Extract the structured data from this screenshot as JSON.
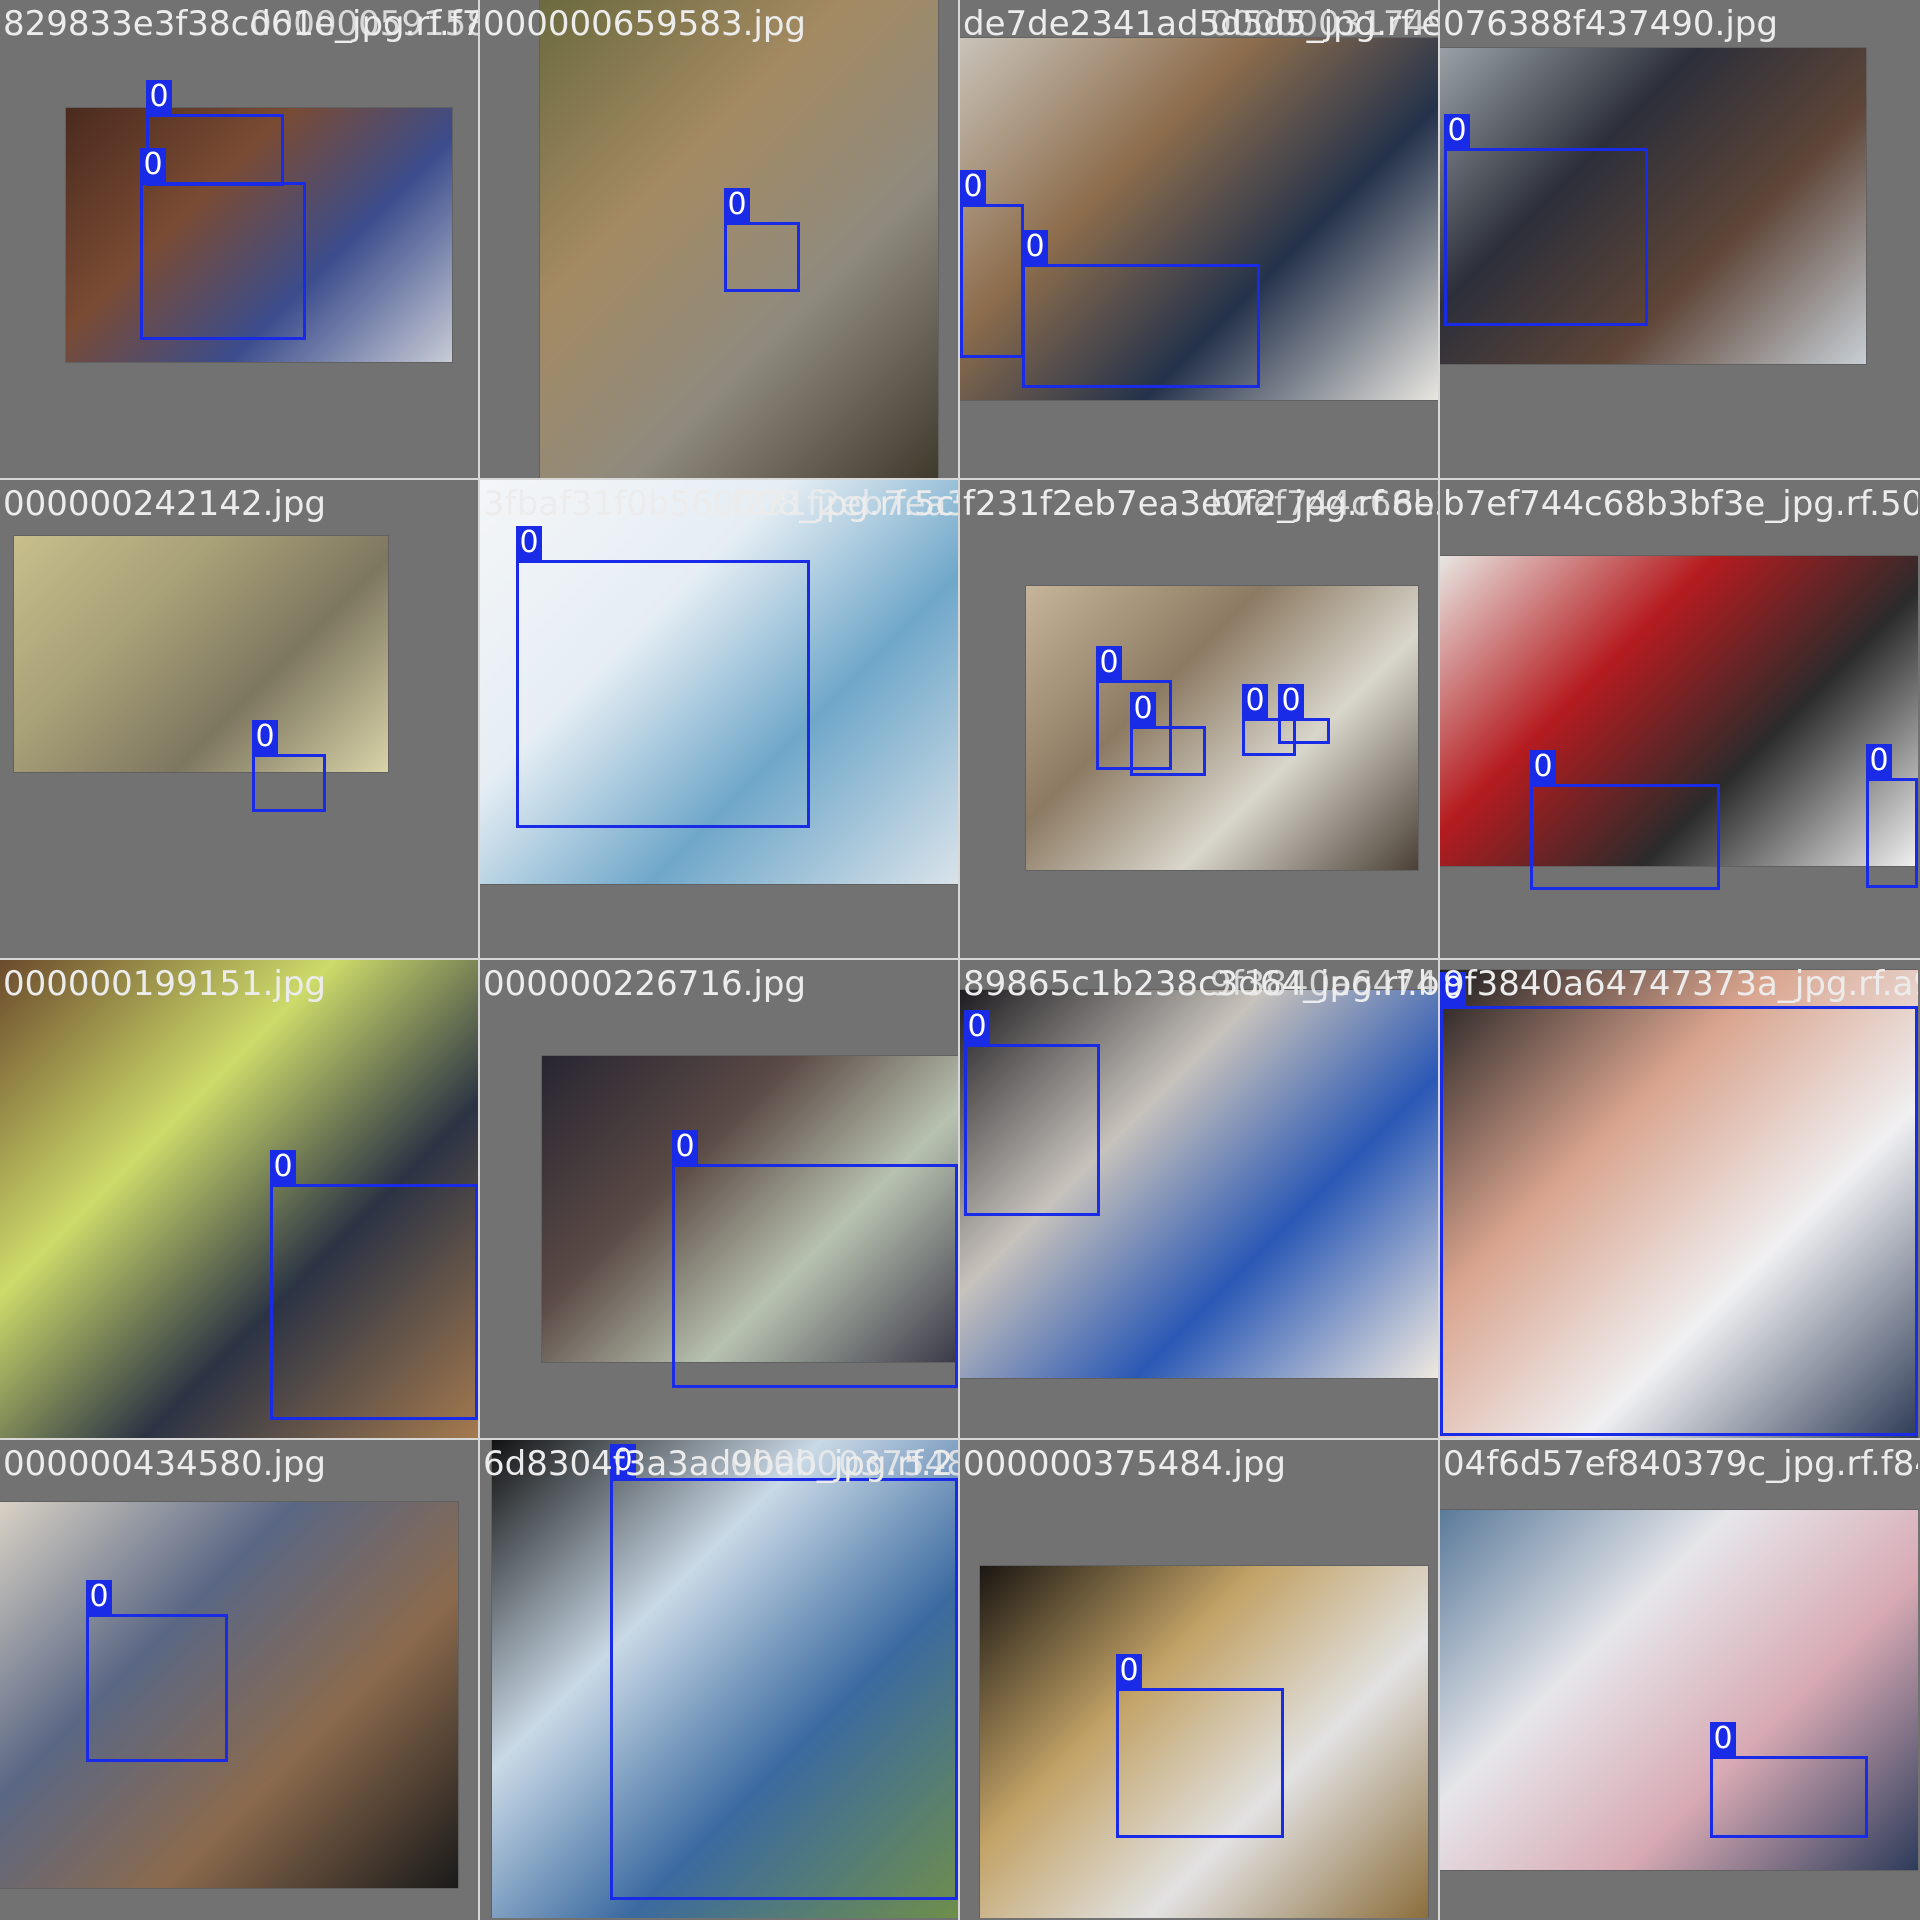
{
  "grid": {
    "tiles": [
      {
        "filename": "829833e3f38cd61e_jpg.rf.f7",
        "overlay": "000000591583.jpg",
        "colors": [
          "#4a2a1e",
          "#7a4b33",
          "#3b4c8c",
          "#c8ccd6"
        ],
        "boxes": [
          {
            "label": "0"
          },
          {
            "label": "0"
          }
        ]
      },
      {
        "filename": "000000659583.jpg",
        "overlay": "",
        "colors": [
          "#6b6a3e",
          "#a48a62",
          "#8f8a7e",
          "#3f3a2c"
        ],
        "boxes": [
          {
            "label": "0"
          }
        ]
      },
      {
        "filename": "de7de2341ad5d5d5_jpg.rf.e",
        "overlay": "000000317490.jpg",
        "colors": [
          "#c9c3b9",
          "#8d6d4c",
          "#24324b",
          "#e8e6e0"
        ],
        "boxes": [
          {
            "label": "0"
          },
          {
            "label": "0"
          }
        ]
      },
      {
        "filename": "076388f437490.jpg",
        "overlay": "",
        "colors": [
          "#9aa1a6",
          "#2c2f3a",
          "#5e4537",
          "#c7cfd6"
        ],
        "boxes": [
          {
            "label": "0"
          }
        ]
      },
      {
        "filename": "000000242142.jpg",
        "overlay": "",
        "colors": [
          "#c8bf8c",
          "#a79f76",
          "#7e7760",
          "#d8d3a8"
        ],
        "boxes": [
          {
            "label": "0"
          }
        ]
      },
      {
        "filename": "3fbaf31f0b560008_jpg.rf.5c9",
        "overlay": "f231f2eb7ea3e0f2_jpg.rf.6e5",
        "colors": [
          "#f4f6f8",
          "#e6eef4",
          "#6fa7c9",
          "#d9e3ea"
        ],
        "boxes": [
          {
            "label": "0"
          }
        ]
      },
      {
        "filename": "f231f2eb7ea3e0f2_jpg.rf.6e5",
        "overlay": "b7ef744c68b3bf3e_jpg.rf.50",
        "colors": [
          "#c6b59a",
          "#8c7a62",
          "#d9d6cc",
          "#4b4036"
        ],
        "boxes": [
          {
            "label": "0"
          },
          {
            "label": "0"
          },
          {
            "label": "0"
          },
          {
            "label": "0"
          }
        ]
      },
      {
        "filename": "b7ef744c68b3bf3e_jpg.rf.50",
        "overlay": "",
        "colors": [
          "#e8e6e2",
          "#b51b1f",
          "#2b2b2b",
          "#f2f2f2"
        ],
        "boxes": [
          {
            "label": "0"
          },
          {
            "label": "0"
          }
        ]
      },
      {
        "filename": "000000199151.jpg",
        "overlay": "",
        "colors": [
          "#6b4a2c",
          "#cddb6a",
          "#2b3344",
          "#a57a4e"
        ],
        "boxes": [
          {
            "label": "0"
          }
        ]
      },
      {
        "filename": "000000226716.jpg",
        "overlay": "",
        "colors": [
          "#272531",
          "#5b4a45",
          "#b8c2b0",
          "#3a3848"
        ],
        "boxes": [
          {
            "label": "0"
          }
        ]
      },
      {
        "filename": "89865c1b238c3d64_jpg.rf.b",
        "overlay": "9f3840a64747373a_jpg.rf.a9",
        "colors": [
          "#1d1b1f",
          "#c7c2bc",
          "#2a58b5",
          "#efe9e0"
        ],
        "boxes": [
          {
            "label": "0"
          }
        ]
      },
      {
        "filename": "9f3840a64747373a_jpg.rf.a9",
        "overlay": "",
        "colors": [
          "#1c1c1e",
          "#d9a48e",
          "#f0f0f2",
          "#2d3b55"
        ],
        "boxes": [
          {
            "label": "0"
          }
        ]
      },
      {
        "filename": "000000434580.jpg",
        "overlay": "",
        "colors": [
          "#d9d2c5",
          "#5a6784",
          "#8b6a4d",
          "#1a1a1a"
        ],
        "boxes": [
          {
            "label": "0"
          }
        ]
      },
      {
        "filename": "6d8304f3a3ad9bab_jpg.rf.2",
        "overlay": "000000375484.jpg",
        "colors": [
          "#111111",
          "#c9d9e6",
          "#3b6aa0",
          "#6f8f4a"
        ],
        "boxes": [
          {
            "label": "0"
          }
        ]
      },
      {
        "filename": "000000375484.jpg",
        "overlay": "",
        "colors": [
          "#1a1612",
          "#c2a266",
          "#e2e2e2",
          "#8c6e3c"
        ],
        "boxes": [
          {
            "label": "0"
          }
        ]
      },
      {
        "filename": "04f6d57ef840379c_jpg.rf.f84",
        "overlay": "",
        "colors": [
          "#5a7a9a",
          "#e6e6ea",
          "#d8aab4",
          "#2c3b5a"
        ],
        "boxes": [
          {
            "label": "0"
          }
        ]
      }
    ]
  }
}
